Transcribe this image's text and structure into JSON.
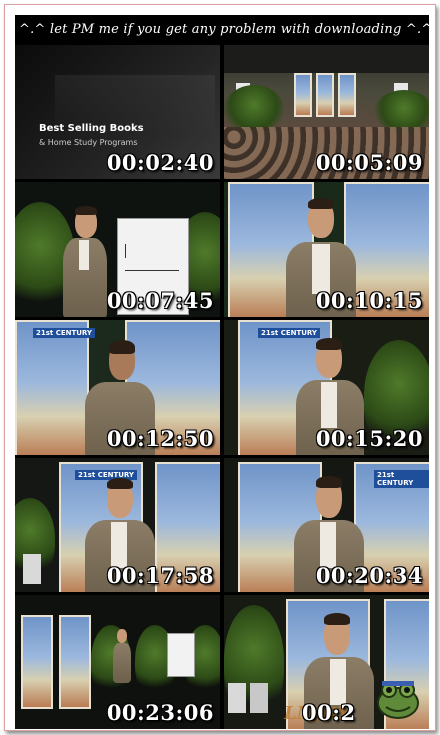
{
  "header": {
    "text": "^.^ let PM me if you get any problem with downloading ^.^"
  },
  "thumbnails": [
    {
      "time": "00:02:40",
      "caption_line1": "Best Selling Books",
      "caption_line2": "& Home Study Programs"
    },
    {
      "time": "00:05:09"
    },
    {
      "time": "00:07:45"
    },
    {
      "time": "00:10:15"
    },
    {
      "time": "00:12:50"
    },
    {
      "time": "00:15:20"
    },
    {
      "time": "00:17:58"
    },
    {
      "time": "00:20:34"
    },
    {
      "time": "00:23:06"
    },
    {
      "time": "00:2",
      "watermark": "LNJOY"
    }
  ],
  "poster_badge": "21st CENTURY",
  "colors": {
    "page_bg": "#ffffff",
    "sheet_bg": "#000000",
    "timestamp_text": "#ffffff",
    "frame_border": "#d9a0a0"
  }
}
